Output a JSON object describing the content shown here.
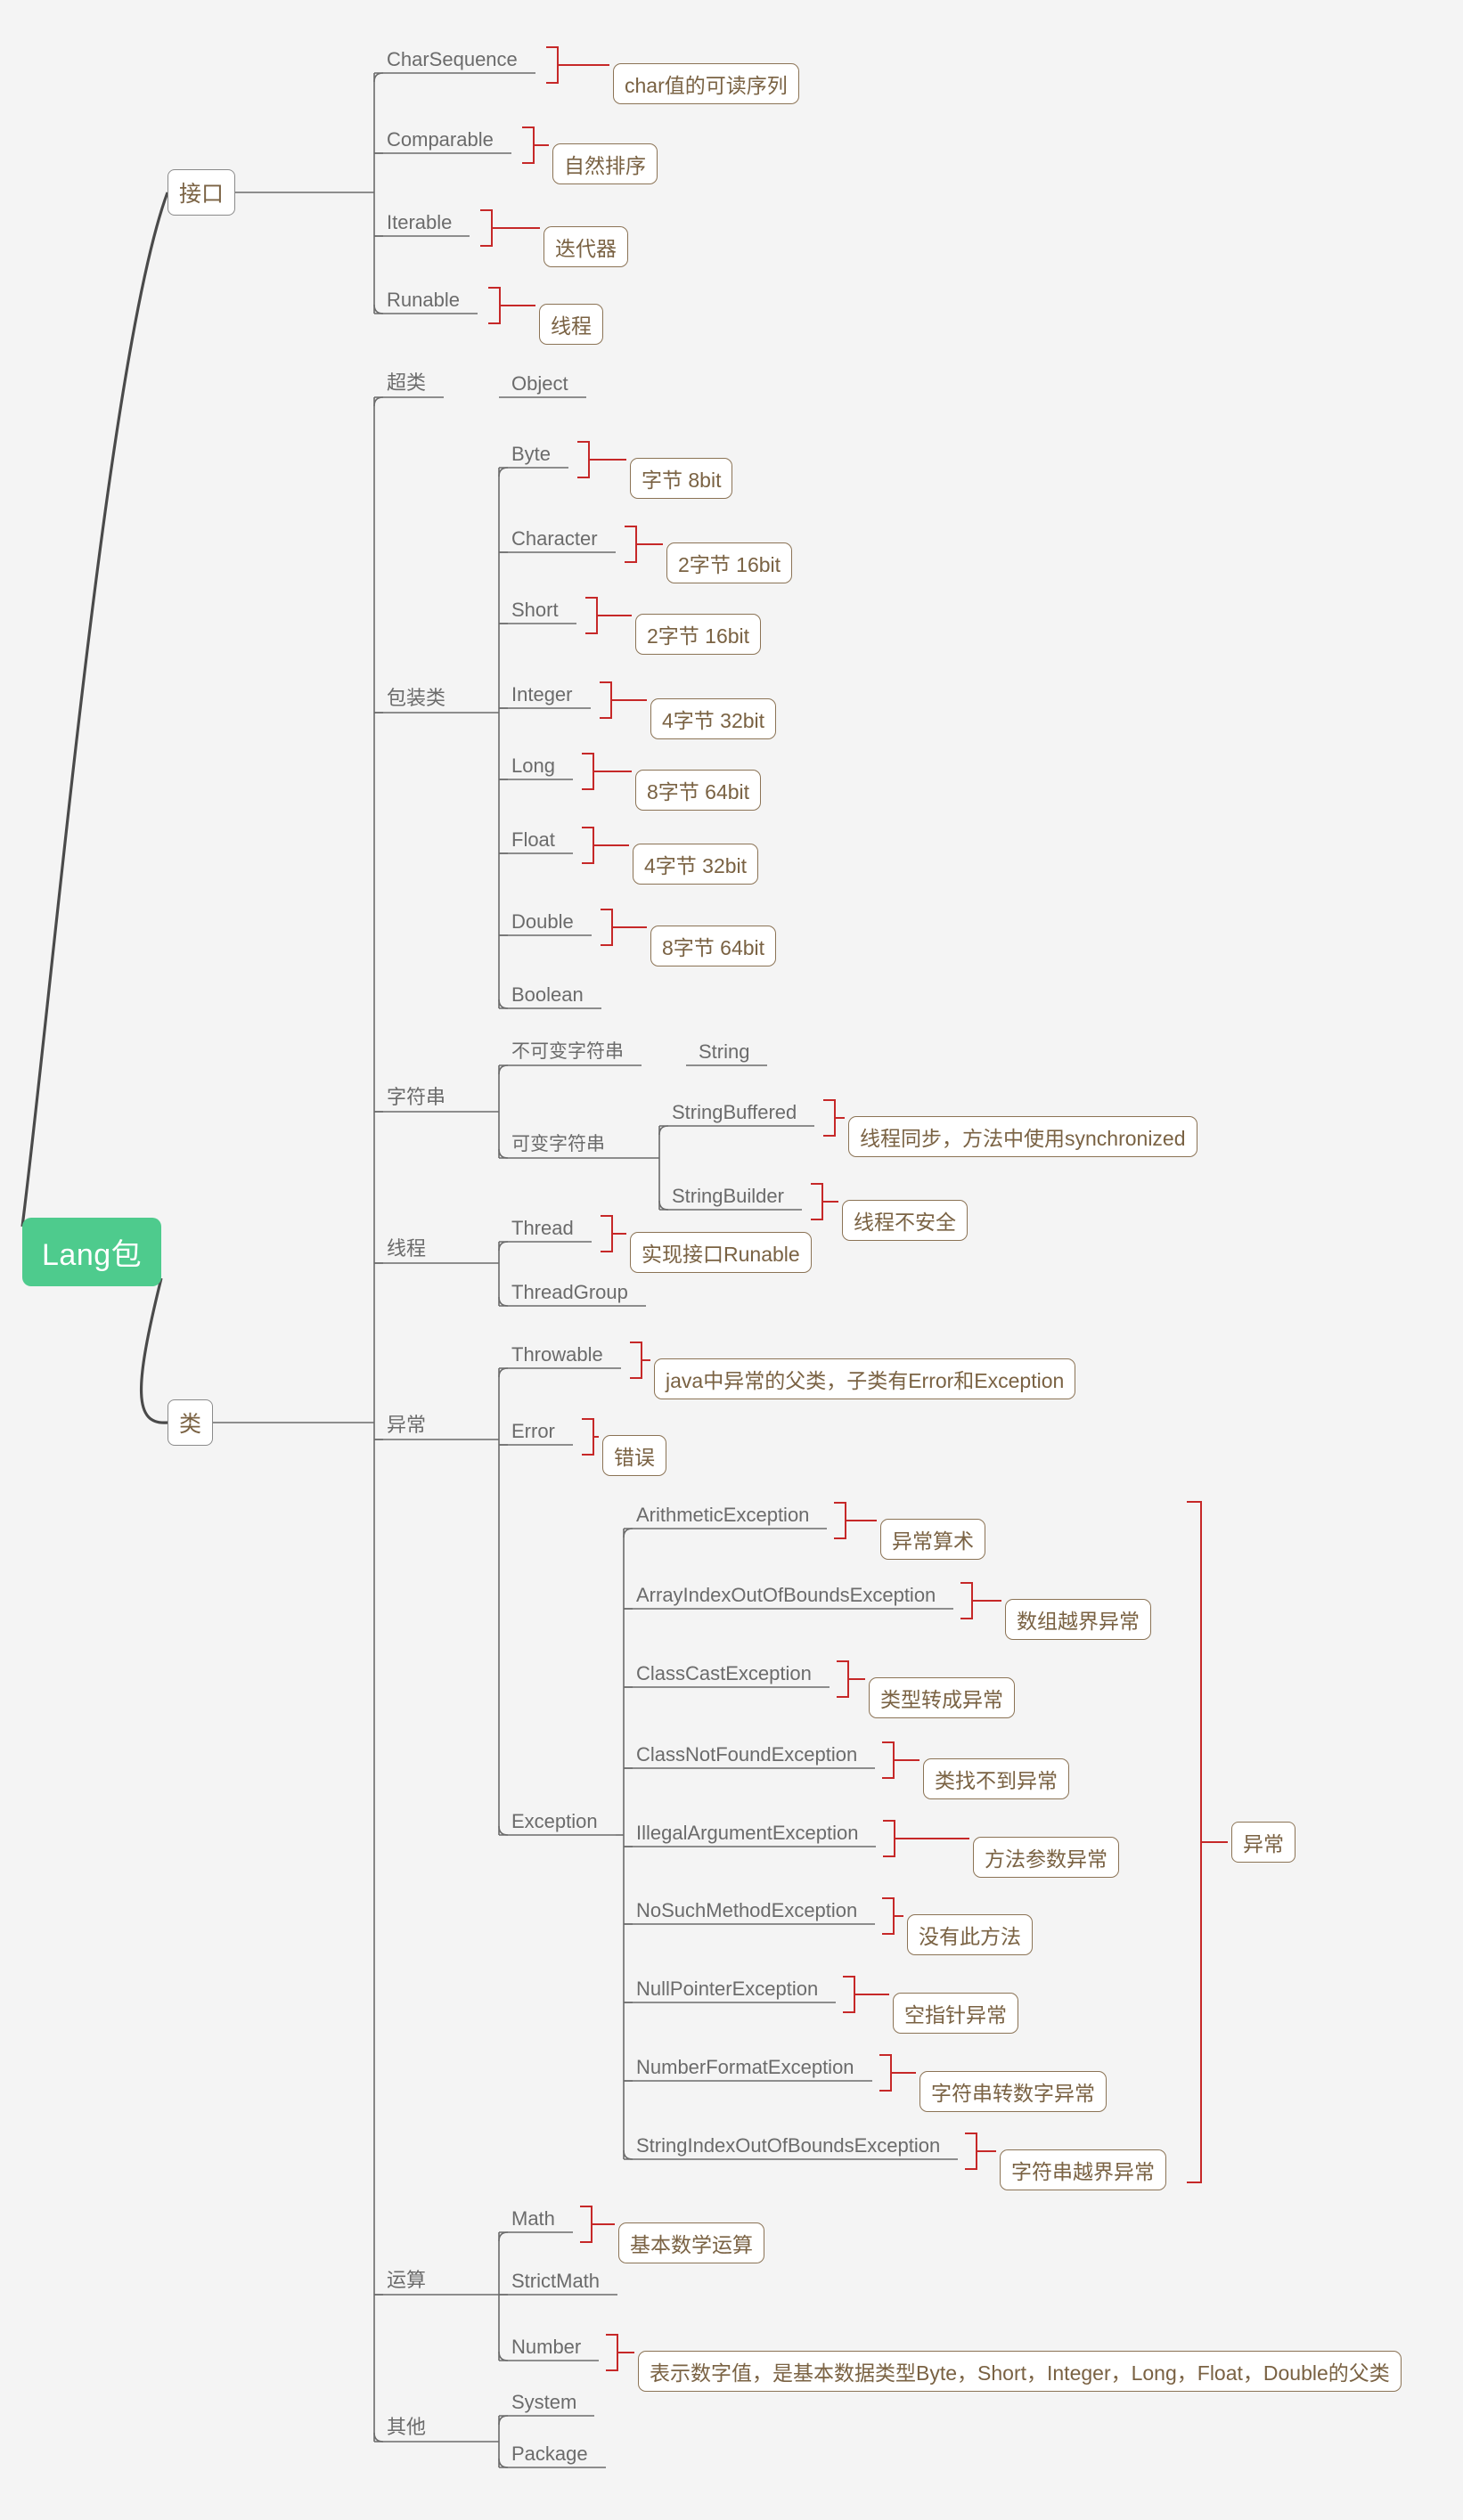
{
  "diagram": {
    "title": "Lang包",
    "root": {
      "label": "Lang包",
      "color": "#4ecb8d"
    },
    "branch_color": "#6b6b6b",
    "callout_color": "#c62828",
    "text_color": "#7a6243",
    "background": "#f4f4f4"
  },
  "interfaces": {
    "label": "接口",
    "items": [
      {
        "name": "CharSequence",
        "note": "char值的可读序列"
      },
      {
        "name": "Comparable",
        "note": "自然排序"
      },
      {
        "name": "Iterable",
        "note": "迭代器"
      },
      {
        "name": "Runable",
        "note": "线程"
      }
    ]
  },
  "classes": {
    "label": "类",
    "groups": [
      {
        "label": "超类",
        "items": [
          {
            "name": "Object",
            "note": ""
          }
        ]
      },
      {
        "label": "包装类",
        "items": [
          {
            "name": "Byte",
            "note": "字节 8bit"
          },
          {
            "name": "Character",
            "note": "2字节 16bit"
          },
          {
            "name": "Short",
            "note": "2字节 16bit"
          },
          {
            "name": "Integer",
            "note": "4字节 32bit"
          },
          {
            "name": "Long",
            "note": "8字节 64bit"
          },
          {
            "name": "Float",
            "note": "4字节 32bit"
          },
          {
            "name": "Double",
            "note": "8字节 64bit"
          },
          {
            "name": "Boolean",
            "note": ""
          }
        ]
      },
      {
        "label": "字符串",
        "subgroups": [
          {
            "label": "不可变字符串",
            "items": [
              {
                "name": "String",
                "note": ""
              }
            ]
          },
          {
            "label": "可变字符串",
            "items": [
              {
                "name": "StringBuffered",
                "note": "线程同步，方法中使用synchronized"
              },
              {
                "name": "StringBuilder",
                "note": "线程不安全"
              }
            ]
          }
        ]
      },
      {
        "label": "线程",
        "items": [
          {
            "name": "Thread",
            "note": "实现接口Runable"
          },
          {
            "name": "ThreadGroup",
            "note": ""
          }
        ]
      },
      {
        "label": "异常",
        "items": [
          {
            "name": "Throwable",
            "note": "java中异常的父类，子类有Error和Exception"
          },
          {
            "name": "Error",
            "note": "错误"
          }
        ],
        "exception_group": {
          "label": "Exception",
          "bracket_label": "异常",
          "items": [
            {
              "name": "ArithmeticException",
              "note": "异常算术"
            },
            {
              "name": "ArrayIndexOutOfBoundsException",
              "note": "数组越界异常"
            },
            {
              "name": "ClassCastException",
              "note": "类型转成异常"
            },
            {
              "name": "ClassNotFoundException",
              "note": "类找不到异常"
            },
            {
              "name": "IllegalArgumentException",
              "note": "方法参数异常"
            },
            {
              "name": "NoSuchMethodException",
              "note": "没有此方法"
            },
            {
              "name": "NullPointerException",
              "note": "空指针异常"
            },
            {
              "name": "NumberFormatException",
              "note": "字符串转数字异常"
            },
            {
              "name": "StringIndexOutOfBoundsException",
              "note": "字符串越界异常"
            }
          ]
        }
      },
      {
        "label": "运算",
        "items": [
          {
            "name": "Math",
            "note": "基本数学运算"
          },
          {
            "name": "StrictMath",
            "note": ""
          },
          {
            "name": "Number",
            "note": "表示数字值，是基本数据类型Byte，Short，Integer，Long，Float，Double的父类"
          }
        ]
      },
      {
        "label": "其他",
        "items": [
          {
            "name": "System",
            "note": ""
          },
          {
            "name": "Package",
            "note": ""
          }
        ]
      }
    ]
  }
}
